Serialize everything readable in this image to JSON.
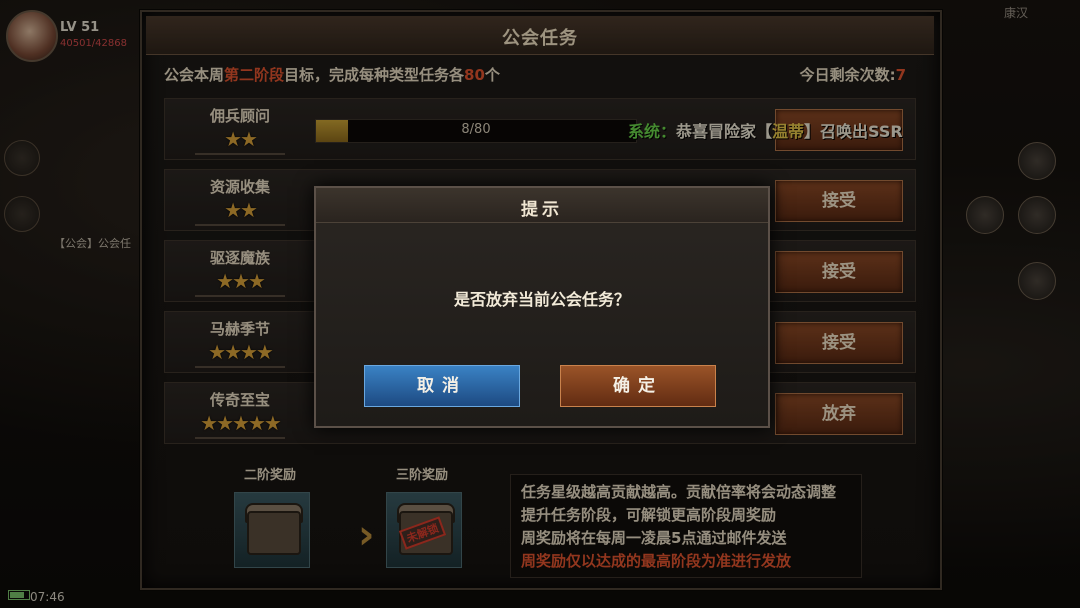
{
  "hud": {
    "level": "LV 51",
    "xp": "40501/42868",
    "guild_chat": "【公会】公会任",
    "time": "07:46",
    "top_right": "康汉"
  },
  "panel": {
    "title": "公会任务",
    "goal_prefix": "公会本周",
    "goal_stage": "第二阶段",
    "goal_mid": "目标，完成每种类型任务各",
    "goal_count": "80",
    "goal_suffix": "个",
    "remain_label": "今日剩余次数:",
    "remain_value": "7"
  },
  "tasks": [
    {
      "name": "佣兵顾问",
      "stars": "★★",
      "progress": "8/80",
      "progress_frac": 0.1,
      "button": ""
    },
    {
      "name": "资源收集",
      "stars": "★★",
      "progress": "",
      "progress_frac": 0,
      "button": "接受"
    },
    {
      "name": "驱逐魔族",
      "stars": "★★★",
      "progress": "",
      "progress_frac": 0,
      "button": "接受"
    },
    {
      "name": "马赫季节",
      "stars": "★★★★",
      "progress": "",
      "progress_frac": 0,
      "button": "接受"
    },
    {
      "name": "传奇至宝",
      "stars": "★★★★★",
      "progress": "",
      "progress_frac": 0,
      "button": "放弃"
    }
  ],
  "rewards": {
    "stage2_label": "二阶奖励",
    "stage3_label": "三阶奖励",
    "locked_stamp": "未解锁",
    "info_lines": [
      "任务星级越高贡献越高。贡献倍率将会动态调整",
      "提升任务阶段，可解锁更高阶段周奖励",
      "周奖励将在每周一凌晨5点通过邮件发送",
      "周奖励仅以达成的最高阶段为准进行发放"
    ]
  },
  "system": {
    "prefix": "系统：",
    "text1": "恭喜冒险家【",
    "player": "温蒂",
    "text2": "】召唤出SSR"
  },
  "modal": {
    "title": "提示",
    "message": "是否放弃当前公会任务？",
    "cancel": "取消",
    "confirm": "确定"
  },
  "colors": {
    "accent_red": "#e0542e",
    "star_gold": "#d9a23a",
    "cancel_blue": "#2a66a8",
    "confirm_brown": "#7a3e1c"
  }
}
